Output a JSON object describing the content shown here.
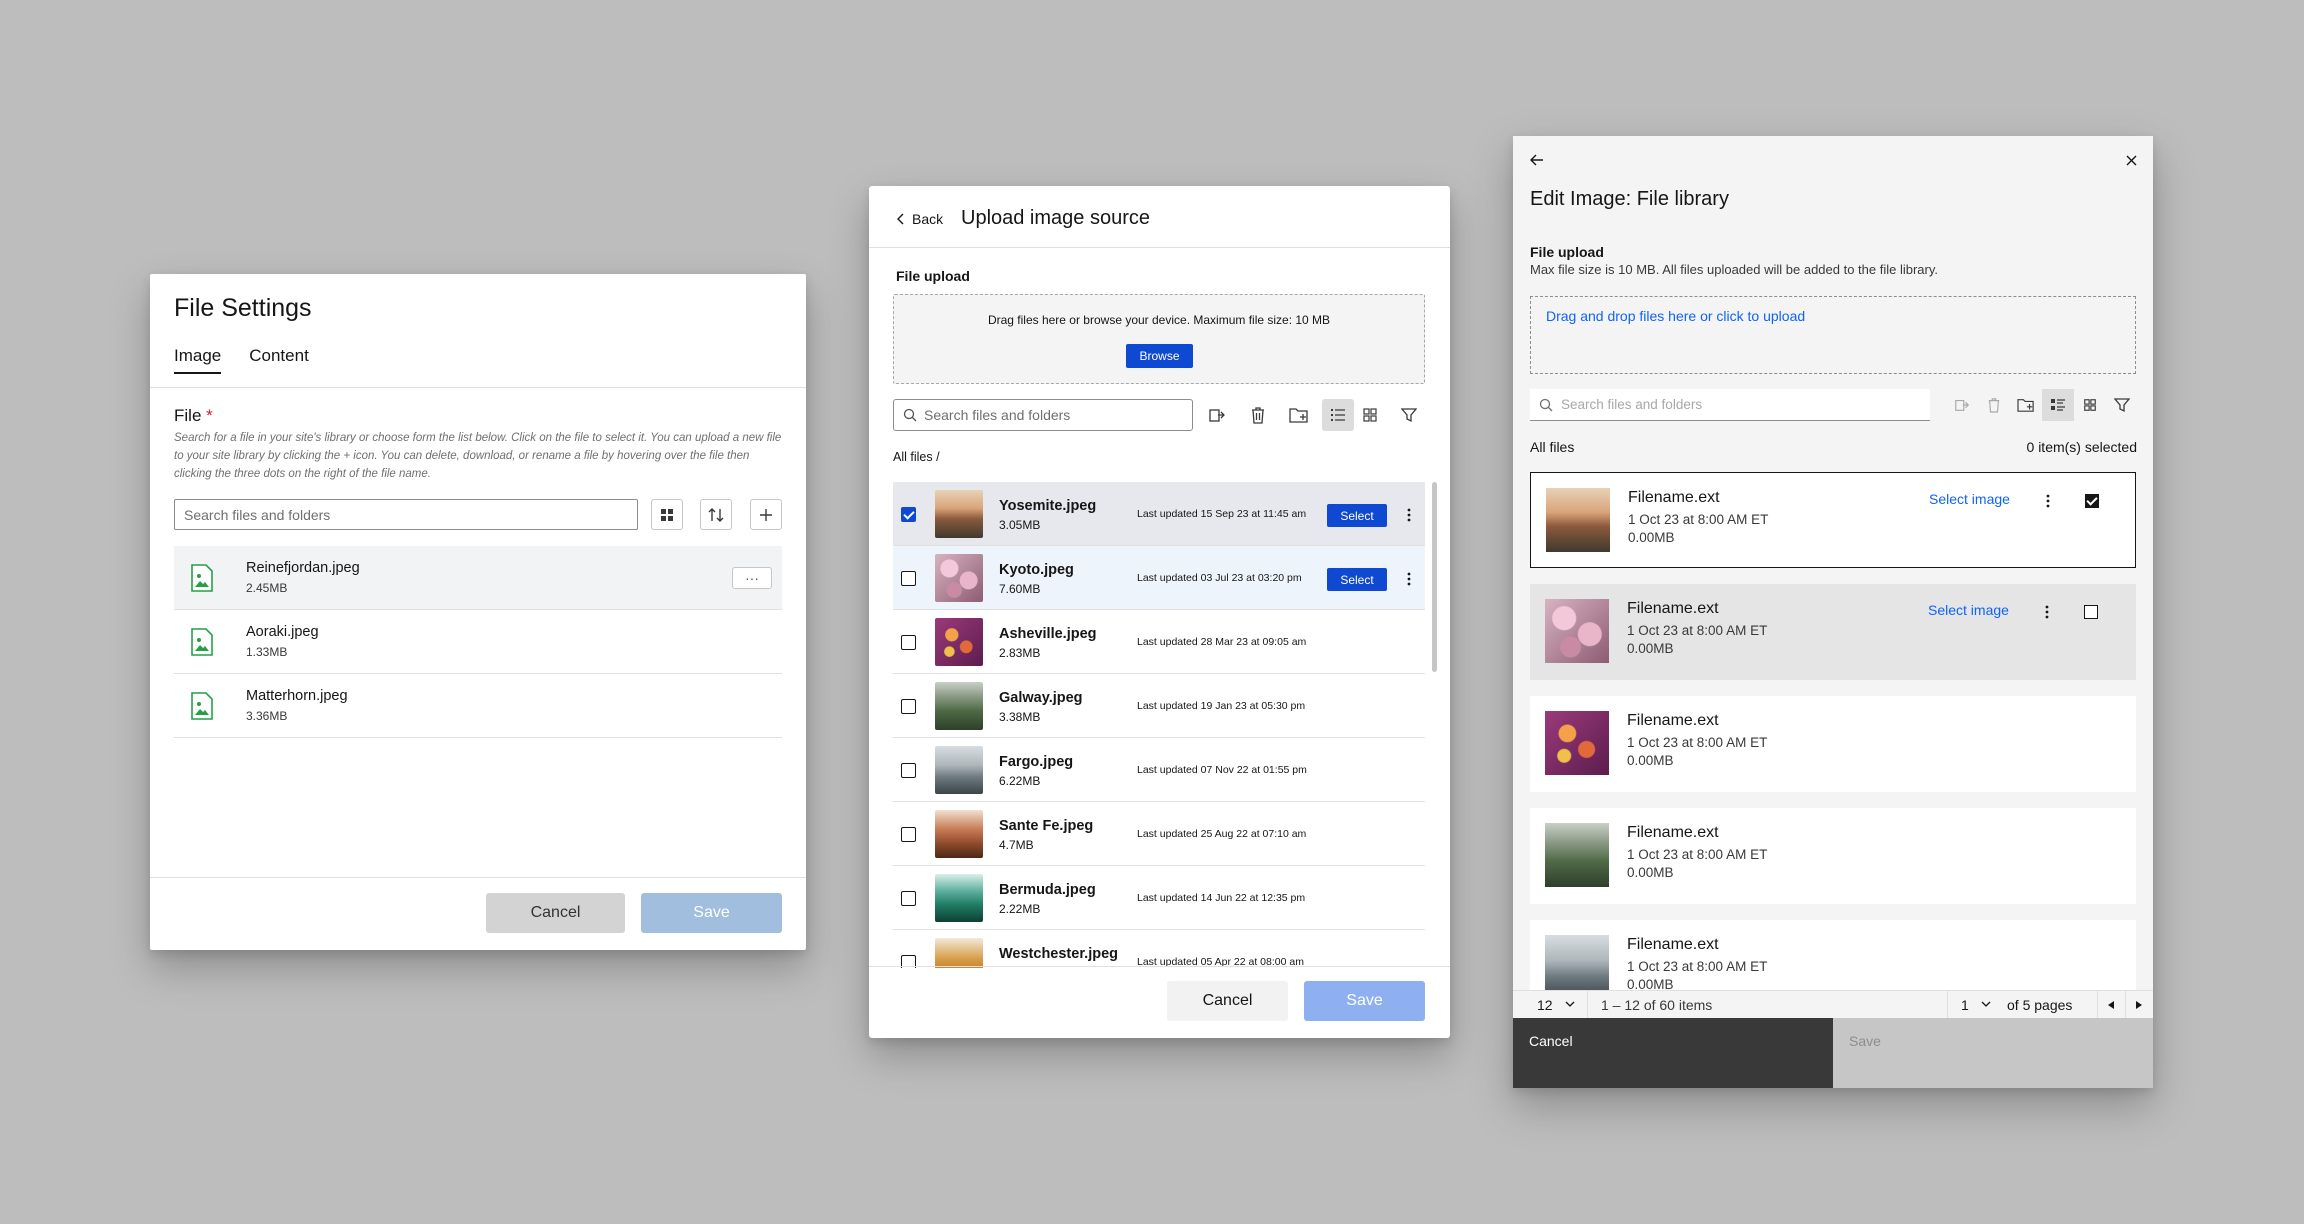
{
  "file_settings": {
    "title": "File Settings",
    "tabs": [
      {
        "label": "Image",
        "active": true
      },
      {
        "label": "Content",
        "active": false
      }
    ],
    "file_label": "File",
    "required_mark": "*",
    "helper": "Search for a file in your site's library or choose form the list below. Click on the file to select it. You can upload a new file to your site library by clicking the + icon. You can delete, download, or rename a file by hovering over the file then clicking the three dots on the right of the file name.",
    "search_placeholder": "Search files and folders",
    "files": [
      {
        "name": "Reinefjordan.jpeg",
        "size": "2.45MB",
        "more": "···"
      },
      {
        "name": "Aoraki.jpeg",
        "size": "1.33MB"
      },
      {
        "name": "Matterhorn.jpeg",
        "size": "3.36MB"
      }
    ],
    "cancel_label": "Cancel",
    "save_label": "Save"
  },
  "upload_source": {
    "back_label": "Back",
    "title": "Upload image source",
    "file_upload_label": "File upload",
    "drop_text": "Drag files here or browse your device. Maximum file size: 10 MB",
    "browse_label": "Browse",
    "search_placeholder": "Search files and folders",
    "breadcrumb": "All files  /",
    "rows": [
      {
        "name": "Yosemite.jpeg",
        "size": "3.05MB",
        "date": "Last updated 15 Sep 23 at 11:45 am",
        "checked": true,
        "select_label": "Select"
      },
      {
        "name": "Kyoto.jpeg",
        "size": "7.60MB",
        "date": "Last updated 03 Jul 23 at 03:20 pm",
        "checked": false,
        "select_label": "Select"
      },
      {
        "name": "Asheville.jpeg",
        "size": "2.83MB",
        "date": "Last updated 28 Mar 23 at 09:05 am",
        "checked": false
      },
      {
        "name": "Galway.jpeg",
        "size": "3.38MB",
        "date": "Last updated 19 Jan 23 at 05:30 pm",
        "checked": false
      },
      {
        "name": "Fargo.jpeg",
        "size": "6.22MB",
        "date": "Last updated 07 Nov 22 at 01:55 pm",
        "checked": false
      },
      {
        "name": "Sante Fe.jpeg",
        "size": "4.7MB",
        "date": "Last updated 25 Aug 22 at 07:10 am",
        "checked": false
      },
      {
        "name": "Bermuda.jpeg",
        "size": "2.22MB",
        "date": "Last updated 14 Jun 22 at 12:35 pm",
        "checked": false
      },
      {
        "name": "Westchester.jpeg",
        "size": "",
        "date": "Last updated 05 Apr 22 at 08:00 am",
        "checked": false
      }
    ],
    "cancel_label": "Cancel",
    "save_label": "Save",
    "colors": {
      "primary": "#0f48d1",
      "save_disabled": "#8fb0f0"
    }
  },
  "file_library": {
    "title": "Edit Image: File library",
    "upload_label": "File upload",
    "upload_helper": "Max file size is 10 MB. All files uploaded will be added to the file library.",
    "drop_link": "Drag and drop files here or click to upload",
    "search_placeholder": "Search files and folders",
    "all_files": "All files",
    "selected_count": "0 item(s) selected",
    "cards": [
      {
        "name": "Filename.ext",
        "date": "1 Oct 23 at 8:00 AM ET",
        "size": "0.00MB",
        "link": "Select image",
        "checked": true
      },
      {
        "name": "Filename.ext",
        "date": "1 Oct 23 at 8:00 AM ET",
        "size": "0.00MB",
        "link": "Select image",
        "checked": false
      },
      {
        "name": "Filename.ext",
        "date": "1 Oct 23 at 8:00 AM ET",
        "size": "0.00MB"
      },
      {
        "name": "Filename.ext",
        "date": "1 Oct 23 at 8:00 AM ET",
        "size": "0.00MB"
      },
      {
        "name": "Filename.ext",
        "date": "1 Oct 23 at 8:00 AM ET",
        "size": "0.00MB"
      }
    ],
    "pager": {
      "page_size": "12",
      "range": "1 – 12 of 60 items",
      "page": "1",
      "of_pages": "of 5 pages"
    },
    "cancel_label": "Cancel",
    "save_label": "Save",
    "colors": {
      "link": "#0f62fe",
      "footer_dark": "#393939"
    }
  }
}
